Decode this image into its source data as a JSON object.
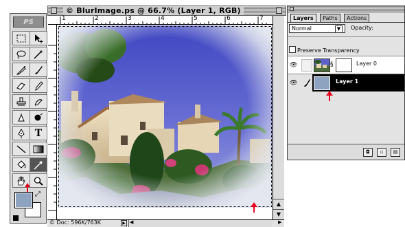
{
  "document": {
    "title": "© BlurImage.ps @ 66.7% (Layer 1, RGB)",
    "ruler_numbers": [
      "1",
      "2",
      "3",
      "4",
      "5",
      "6",
      "7"
    ],
    "status_text": "Doc: 596K/763K"
  },
  "toolbox": {
    "tools": [
      {
        "name": "marquee-tool"
      },
      {
        "name": "move-tool"
      },
      {
        "name": "lasso-tool"
      },
      {
        "name": "magic-wand-tool"
      },
      {
        "name": "airbrush-tool"
      },
      {
        "name": "paintbrush-tool"
      },
      {
        "name": "eraser-tool"
      },
      {
        "name": "pencil-tool"
      },
      {
        "name": "rubber-stamp-tool"
      },
      {
        "name": "smudge-tool"
      },
      {
        "name": "dodge-tool"
      },
      {
        "name": "burn-tool"
      },
      {
        "name": "pen-tool"
      },
      {
        "name": "type-tool"
      },
      {
        "name": "line-tool"
      },
      {
        "name": "gradient-tool"
      },
      {
        "name": "paint-bucket-tool"
      },
      {
        "name": "eyedropper-tool"
      },
      {
        "name": "hand-tool"
      },
      {
        "name": "zoom-tool"
      }
    ],
    "type_glyph": "T",
    "foreground_color": "#8da3c0",
    "background_color": "#ffffff"
  },
  "layers_palette": {
    "tabs": [
      "Layers",
      "Paths",
      "Actions"
    ],
    "active_tab": "Layers",
    "blend_mode": "Normal",
    "opacity_label": "Opacity:",
    "preserve_transparency_label": "Preserve Transparency",
    "layers": [
      {
        "name": "Layer 0",
        "selected": false
      },
      {
        "name": "Layer 1",
        "selected": true,
        "fill_color": "#8da3c0"
      }
    ]
  },
  "annotation_color": "#e8001c"
}
